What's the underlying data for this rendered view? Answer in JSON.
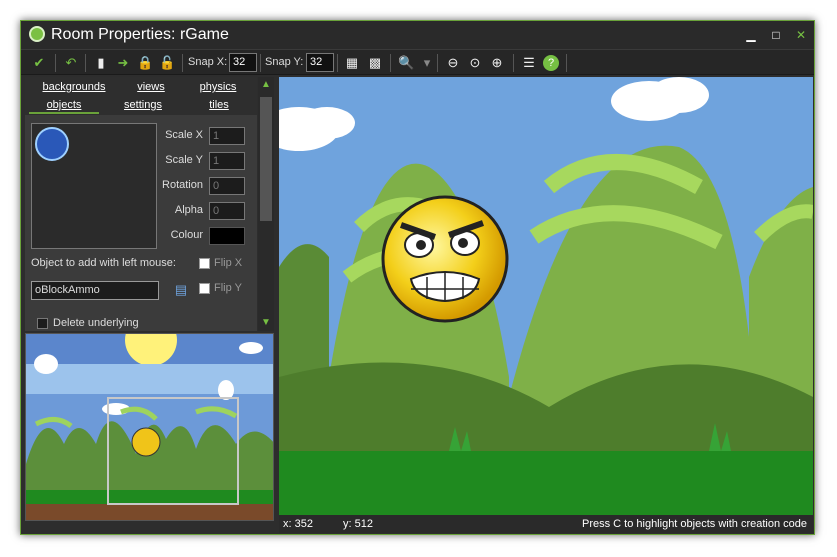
{
  "window": {
    "title": "Room Properties: rGame"
  },
  "toolbar": {
    "snap_x_label": "Snap X:",
    "snap_x_value": "32",
    "snap_y_label": "Snap Y:",
    "snap_y_value": "32"
  },
  "tabs": [
    {
      "label": "backgrounds"
    },
    {
      "label": "views"
    },
    {
      "label": "physics"
    },
    {
      "label": "objects"
    },
    {
      "label": "settings"
    },
    {
      "label": "tiles"
    }
  ],
  "properties": {
    "scale_x_label": "Scale X",
    "scale_x_value": "1",
    "scale_y_label": "Scale Y",
    "scale_y_value": "1",
    "rotation_label": "Rotation",
    "rotation_value": "0",
    "alpha_label": "Alpha",
    "alpha_value": "0",
    "colour_label": "Colour",
    "object_to_add_label": "Object to add with left mouse:",
    "object_value": "oBlockAmmo",
    "flip_x_label": "Flip X",
    "flip_y_label": "Flip Y",
    "delete_underlying_label": "Delete underlying"
  },
  "status": {
    "x": "x: 352",
    "y": "y: 512",
    "hint": "Press C to highlight objects with creation code"
  },
  "colors": {
    "accent": "#6aa23a",
    "sky": "#6fa3dd",
    "grass": "#1f7d1f"
  }
}
